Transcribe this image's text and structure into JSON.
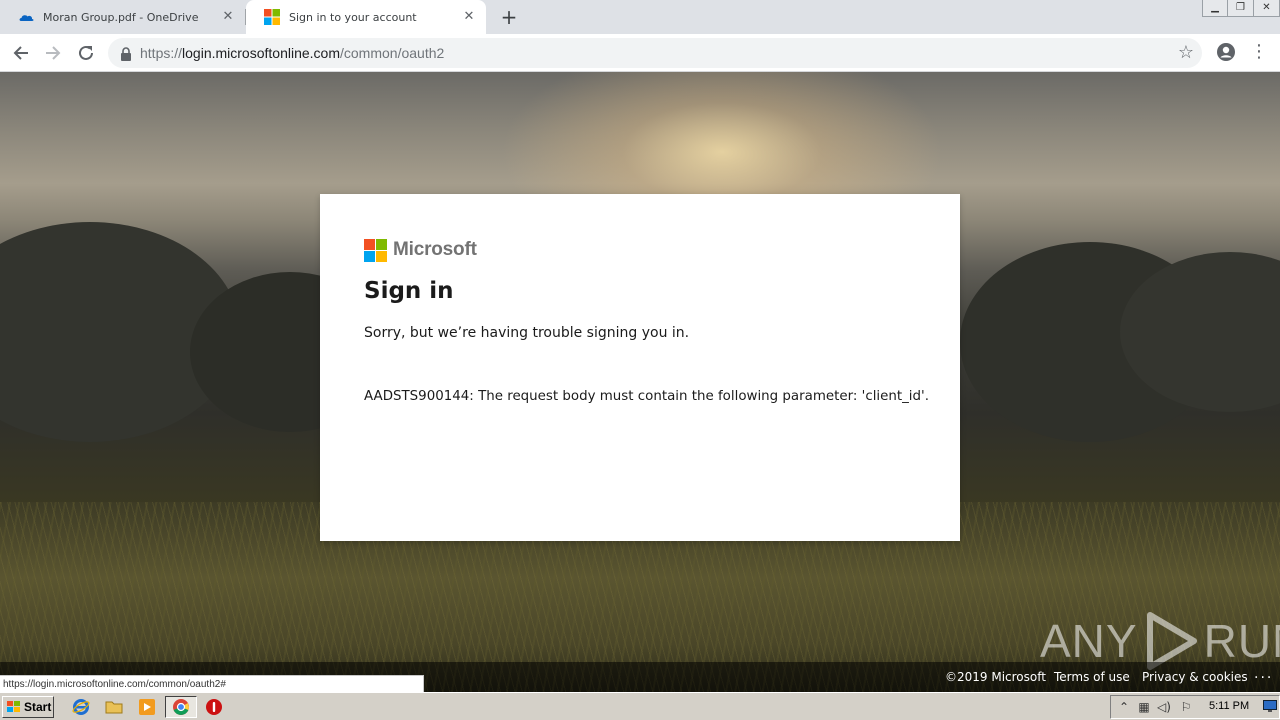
{
  "browser": {
    "tabs": [
      {
        "title": "Moran Group.pdf - OneDrive",
        "icon": "onedrive-icon",
        "active": false
      },
      {
        "title": "Sign in to your account",
        "icon": "microsoft-icon",
        "active": true
      }
    ],
    "url": {
      "scheme": "https://",
      "host": "login.microsoftonline.com",
      "path": "/common/oauth2"
    },
    "status_url": "https://login.microsoftonline.com/common/oauth2#"
  },
  "signin": {
    "brand": "Microsoft",
    "title": "Sign in",
    "message": "Sorry, but we’re having trouble signing you in.",
    "error": "AADSTS900144: The request body must contain the following parameter: 'client_id'."
  },
  "footer": {
    "copyright": "©2019 Microsoft",
    "terms": "Terms of use",
    "privacy": "Privacy & cookies",
    "more": "..."
  },
  "watermark": {
    "left": "ANY",
    "right": "RUN"
  },
  "taskbar": {
    "start_label": "Start",
    "clock": "5:11 PM"
  },
  "colors": {
    "ms_red": "#f25022",
    "ms_green": "#7fba00",
    "ms_blue": "#00a4ef",
    "ms_yellow": "#ffb900"
  }
}
